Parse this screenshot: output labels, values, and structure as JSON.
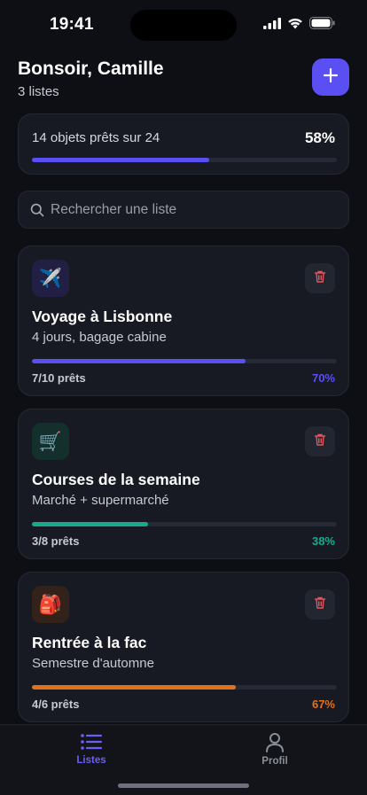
{
  "status": {
    "time": "19:41"
  },
  "header": {
    "greeting": "Bonsoir, Camille",
    "list_count": "3 listes"
  },
  "summary": {
    "text": "14 objets prêts sur 24",
    "percent_label": "58%",
    "progress": 0.58,
    "color": "#5a4ff2"
  },
  "search": {
    "placeholder": "Rechercher une liste"
  },
  "lists": [
    {
      "icon": "airplane-icon",
      "emoji": "✈️",
      "icon_bg": "#221f45",
      "title": "Voyage à Lisbonne",
      "subtitle": "4 jours, bagage cabine",
      "ready": "7/10 prêts",
      "percent_label": "70%",
      "progress": 0.7,
      "color": "#5a4ff2"
    },
    {
      "icon": "shopping-cart-icon",
      "emoji": "🛒",
      "icon_bg": "#13302c",
      "title": "Courses de la semaine",
      "subtitle": "Marché + supermarché",
      "ready": "3/8 prêts",
      "percent_label": "38%",
      "progress": 0.38,
      "color": "#1ba98e"
    },
    {
      "icon": "backpack-icon",
      "emoji": "🎒",
      "icon_bg": "#33221a",
      "title": "Rentrée à la fac",
      "subtitle": "Semestre d'automne",
      "ready": "4/6 prêts",
      "percent_label": "67%",
      "progress": 0.67,
      "color": "#e2711c"
    }
  ],
  "tabs": [
    {
      "label": "Listes",
      "icon": "list-icon",
      "active": true
    },
    {
      "label": "Profil",
      "icon": "profile-icon",
      "active": false
    }
  ],
  "colors": {
    "accent": "#5a4ff2",
    "background": "#0d0f15",
    "card": "#171a22",
    "danger": "#e0575b",
    "inactive": "#8a8e99"
  }
}
